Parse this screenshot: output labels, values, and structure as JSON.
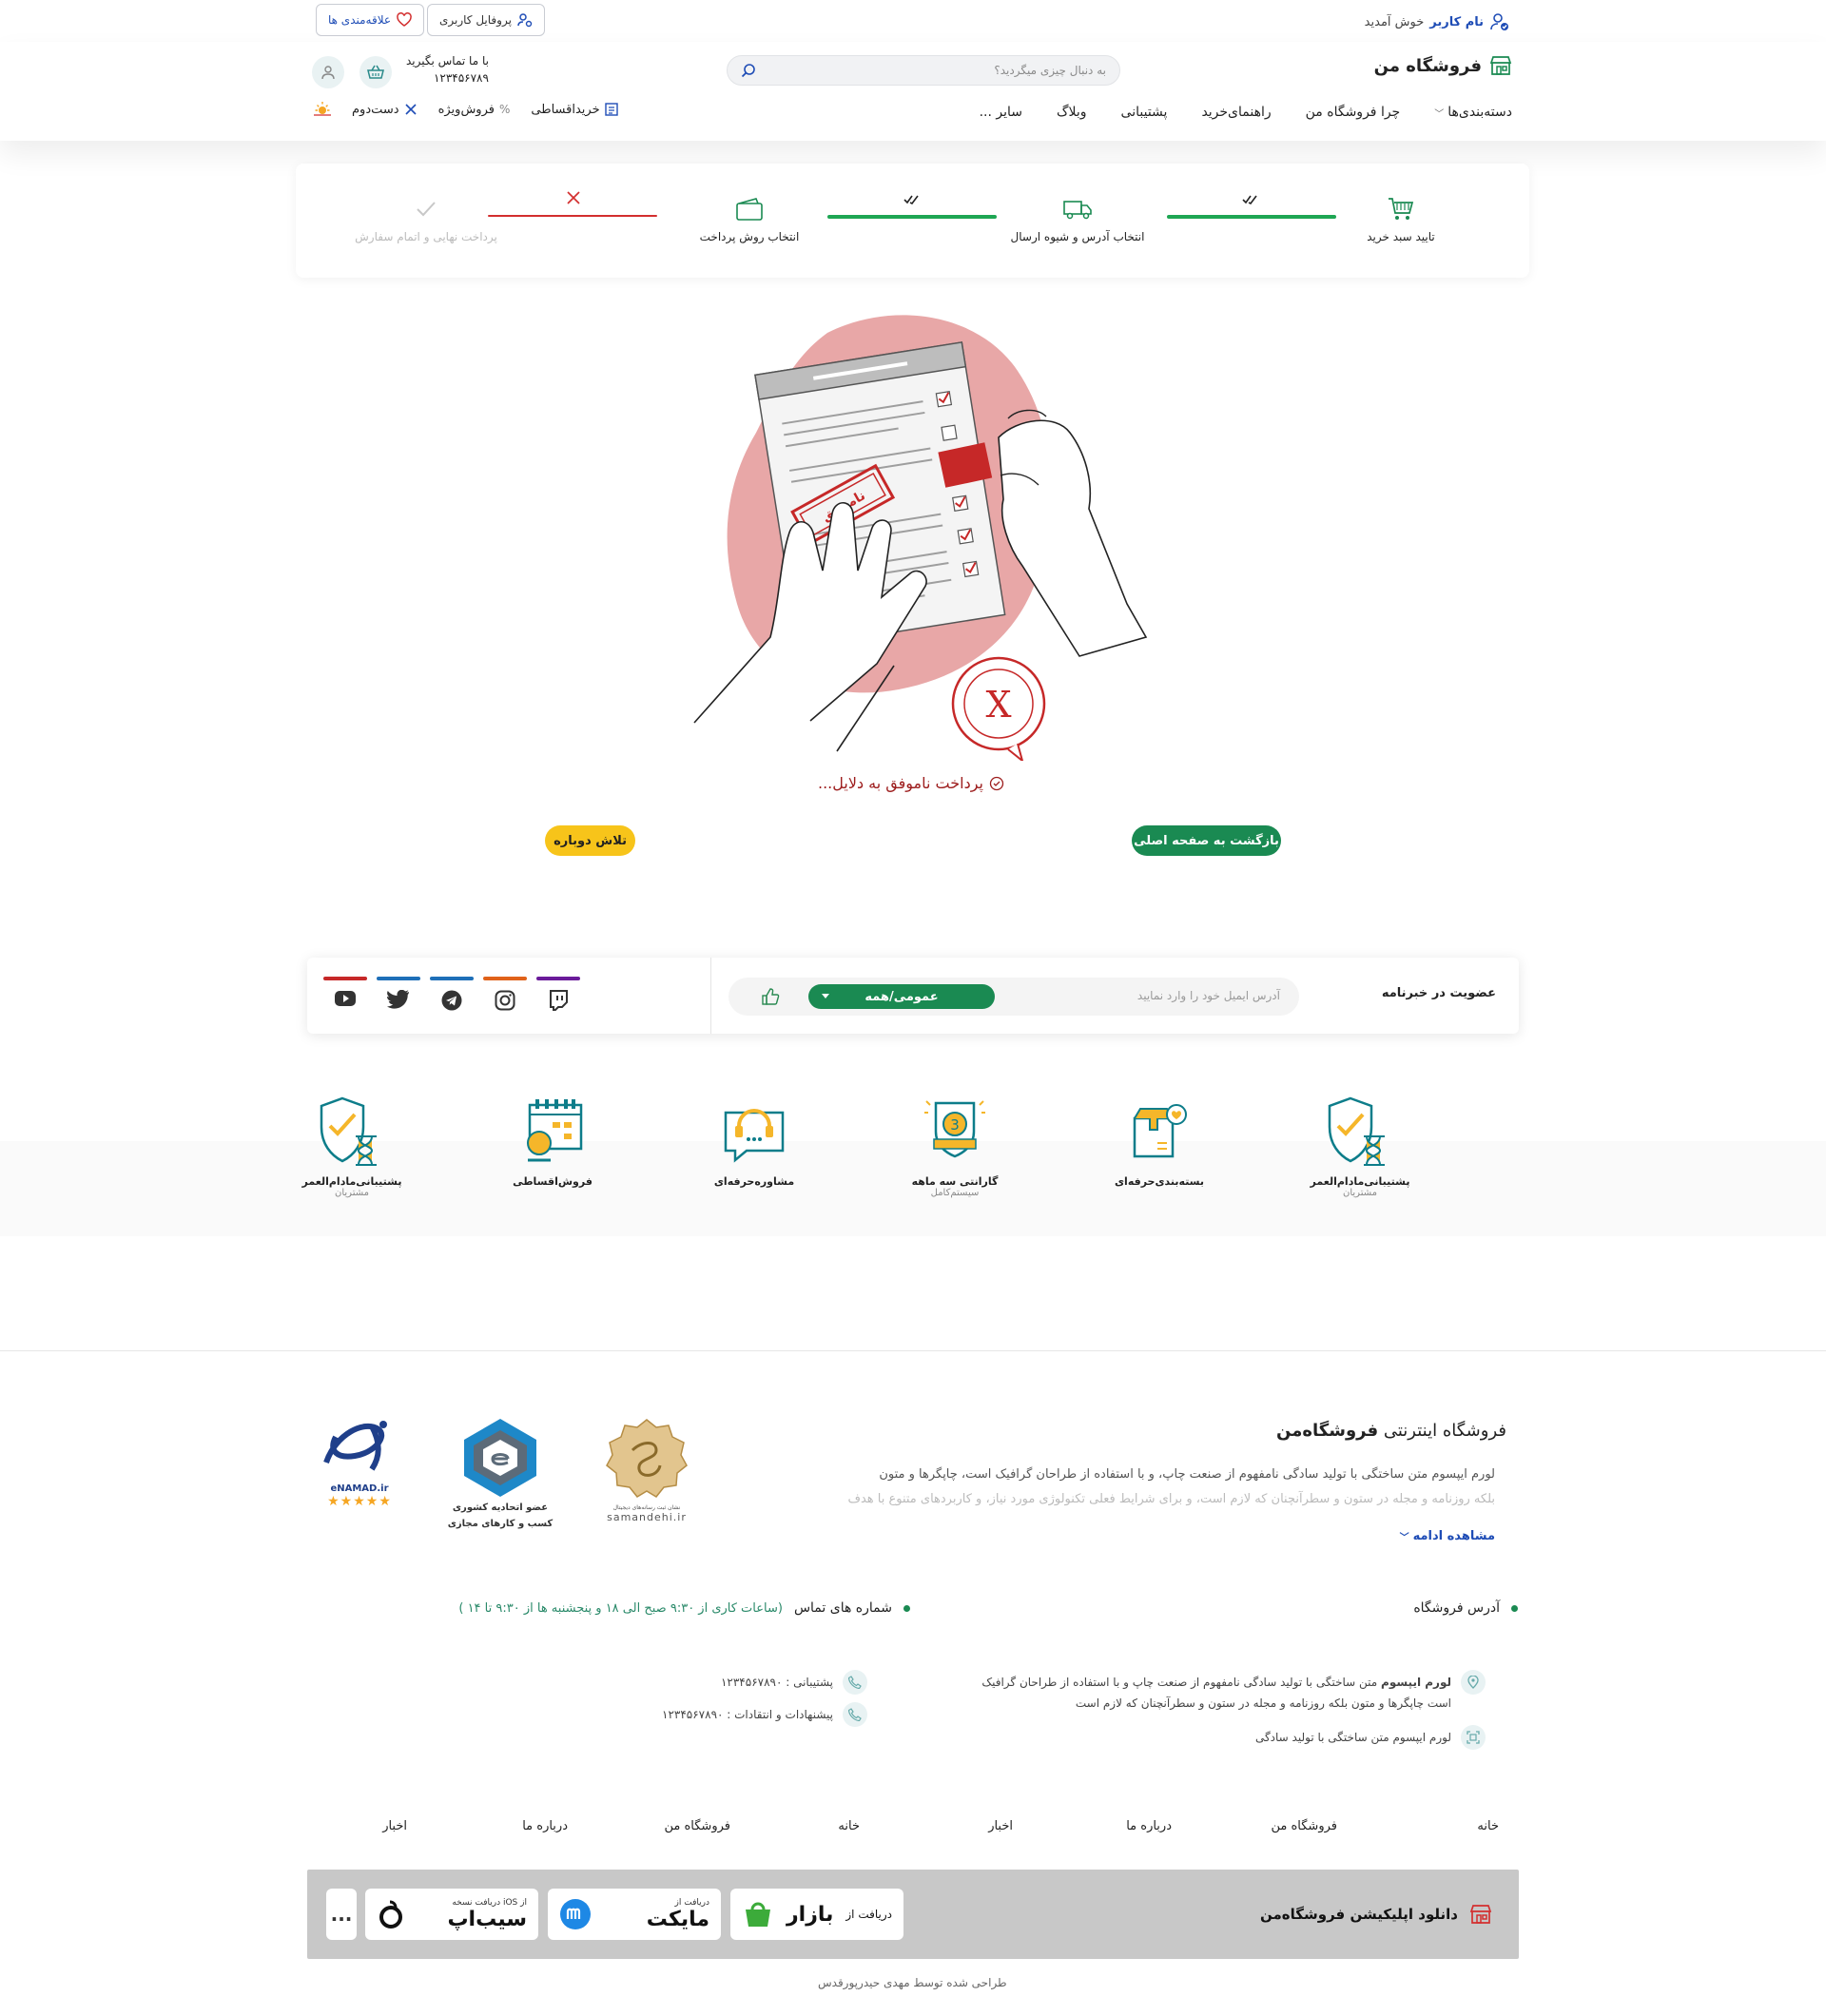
{
  "topbar": {
    "welcome_user": "نام کاربر",
    "welcome_text": "خوش آمدید",
    "profile_btn": "پروفایل کاربری",
    "wishlist_btn": "علاقه‌مندی ها"
  },
  "header": {
    "brand": "فروشگاه من",
    "search_placeholder": "به دنبال چیزی میگردید؟",
    "contact_label": "با ما تماس بگیرید",
    "contact_phone": "۱۲۳۴۵۶۷۸۹",
    "nav": [
      "دسته‌بندی‌ها",
      "چرا فروشگاه من",
      "راهنمای‌خرید",
      "پشتیبانی",
      "وبلاگ",
      "سایر ..."
    ],
    "subnav": [
      "خریداقساطی",
      "فروش‌ویژه",
      "دست‌دوم"
    ]
  },
  "steps": [
    {
      "label": "تایید سبد خرید",
      "icon": "cart-icon",
      "status": "done"
    },
    {
      "label": "انتخاب آدرس و شیوه ارسال",
      "icon": "truck-icon",
      "status": "done"
    },
    {
      "label": "انتخاب روش پرداخت",
      "icon": "wallet-icon",
      "status": "failed"
    },
    {
      "label": "پرداخت نهایی و اتمام سفارش",
      "icon": "check-icon",
      "status": "pending"
    }
  ],
  "illustration": {
    "stamp_text": "ناموفق"
  },
  "result": {
    "message": "پرداخت ناموفق به دلایل...",
    "home_btn": "بازگشت به صفحه اصلی",
    "retry_btn": "تلاش دوباره"
  },
  "newsletter": {
    "label": "عضویت در خبرنامه",
    "email_placeholder": "آدرس ایمیل خود را وارد نمایید",
    "select_value": "عمومی/همه",
    "social": [
      {
        "icon": "youtube-icon",
        "color": "#c62828"
      },
      {
        "icon": "twitter-icon",
        "color": "#1e6fb8"
      },
      {
        "icon": "telegram-icon",
        "color": "#1e6fb8"
      },
      {
        "icon": "instagram-icon",
        "color": "#e0621a"
      },
      {
        "icon": "twitch-icon",
        "color": "#6a1b9a"
      }
    ]
  },
  "features": [
    {
      "caption": "پشتیبانی‌مادام‌العمر",
      "sub": "مشتریان"
    },
    {
      "caption": "بسته‌بندی‌حرفه‌ای",
      "sub": ""
    },
    {
      "caption": "گارانتی سه ماهه",
      "sub": "سیستم‌کامل"
    },
    {
      "caption": "مشاوره‌حرفه‌ای",
      "sub": ""
    },
    {
      "caption": "فروش‌اقساطی",
      "sub": ""
    },
    {
      "caption": "پشتیبانی‌مادام‌العمر",
      "sub": "مشتریان"
    }
  ],
  "footer": {
    "title_prefix": "فروشگاه اینترنتی",
    "title_brand": "فروشگاه‌من",
    "about_line1": "لورم ایپسوم متن ساختگی با تولید سادگی نامفهوم از صنعت چاپ، و با استفاده از طراحان گرافیک است، چاپگرها و متون",
    "about_line2": "بلکه روزنامه و مجله در ستون و سطرآنچنان که لازم است، و برای شرایط فعلی تکنولوژی مورد نیاز، و کاربردهای متنوع با هدف",
    "read_more": "مشاهده ادامه",
    "badges": [
      "samandehi.ir",
      "عضو اتحادیه کشوری",
      "کسب و کارهای مجازی",
      "eNAMAD.ir"
    ],
    "badge_small": "نشان ثبت رسانه‌های دیجیتال",
    "address_title": "آدرس فروشگاه",
    "address_bold": "لورم ایپسوم",
    "address_line1": " متن ساختگی با تولید سادگی نامفهوم از صنعت چاپ و با استفاده از طراحان گرافیک",
    "address_line2": "است چاپگرها و متون بلکه روزنامه و مجله در ستون و سطرآنچنان که لازم است",
    "address_line3": "لورم ایپسوم متن ساختگی با تولید سادگی",
    "phones_title": "شماره های تماس",
    "phones_hours": "(ساعات کاری از ۹:۳۰ صبح الی ۱۸ و پنجشنبه ها از ۹:۳۰ تا ۱۴ )",
    "support_phone": "پشتیبانی : ۱۲۳۴۵۶۷۸۹۰",
    "feedback_phone": "پیشنهادات و انتقادات : ۱۲۳۴۵۶۷۸۹۰",
    "links": [
      "خانه",
      "فروشگاه من",
      "درباره ما",
      "اخبار",
      "خانه",
      "فروشگاه من",
      "درباره ما",
      "اخبار"
    ],
    "app_label": "دانلود اپلیکیشن فروشگاه‌من",
    "stores": [
      {
        "top": "دریافت از",
        "name": "بازار"
      },
      {
        "top": "دریافت از",
        "name": "مایکت"
      },
      {
        "top": "دریافت نسخه iOS از",
        "name": "سیب‌اپ"
      }
    ],
    "more_stores": "...",
    "credit": "طراحی شده توسط مهدی حیدرپورقدس"
  }
}
